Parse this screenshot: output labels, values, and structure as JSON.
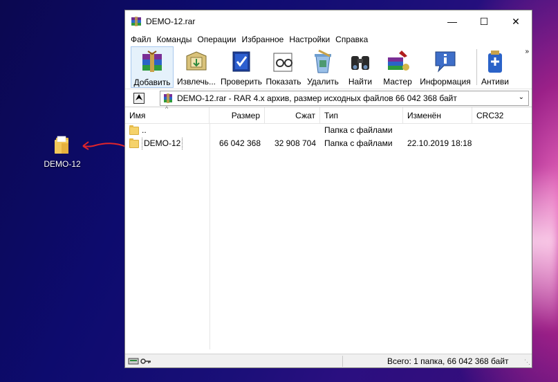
{
  "desktop": {
    "icon_label": "DEMO-12"
  },
  "window": {
    "title": "DEMO-12.rar",
    "controls": {
      "minimize": "—",
      "maximize": "☐",
      "close": "✕"
    }
  },
  "menu": [
    "Файл",
    "Команды",
    "Операции",
    "Избранное",
    "Настройки",
    "Справка"
  ],
  "toolbar": {
    "buttons": [
      {
        "label": "Добавить",
        "icon": "add-archive-icon"
      },
      {
        "label": "Извлечь...",
        "icon": "extract-icon"
      },
      {
        "label": "Проверить",
        "icon": "test-icon"
      },
      {
        "label": "Показать",
        "icon": "view-icon"
      },
      {
        "label": "Удалить",
        "icon": "delete-icon"
      },
      {
        "label": "Найти",
        "icon": "find-icon"
      },
      {
        "label": "Мастер",
        "icon": "wizard-icon"
      },
      {
        "label": "Информация",
        "icon": "info-icon"
      },
      {
        "label": "Антиви",
        "icon": "antivirus-icon"
      }
    ],
    "more": "»"
  },
  "address": {
    "up_glyph": "⮝",
    "text": "DEMO-12.rar - RAR 4.x архив, размер исходных файлов 66 042 368 байт"
  },
  "columns": [
    "Имя",
    "Размер",
    "Сжат",
    "Тип",
    "Изменён",
    "CRC32"
  ],
  "rows": [
    {
      "name": "..",
      "size": "",
      "packed": "",
      "type": "Папка с файлами",
      "modified": "",
      "crc": ""
    },
    {
      "name": "DEMO-12",
      "size": "66 042 368",
      "packed": "32 908 704",
      "type": "Папка с файлами",
      "modified": "22.10.2019 18:18",
      "crc": ""
    }
  ],
  "status": {
    "text": "Всего: 1 папка, 66 042 368 байт"
  },
  "colors": {
    "accent_arrow": "#e0252b",
    "folder": "#f5d26a"
  }
}
